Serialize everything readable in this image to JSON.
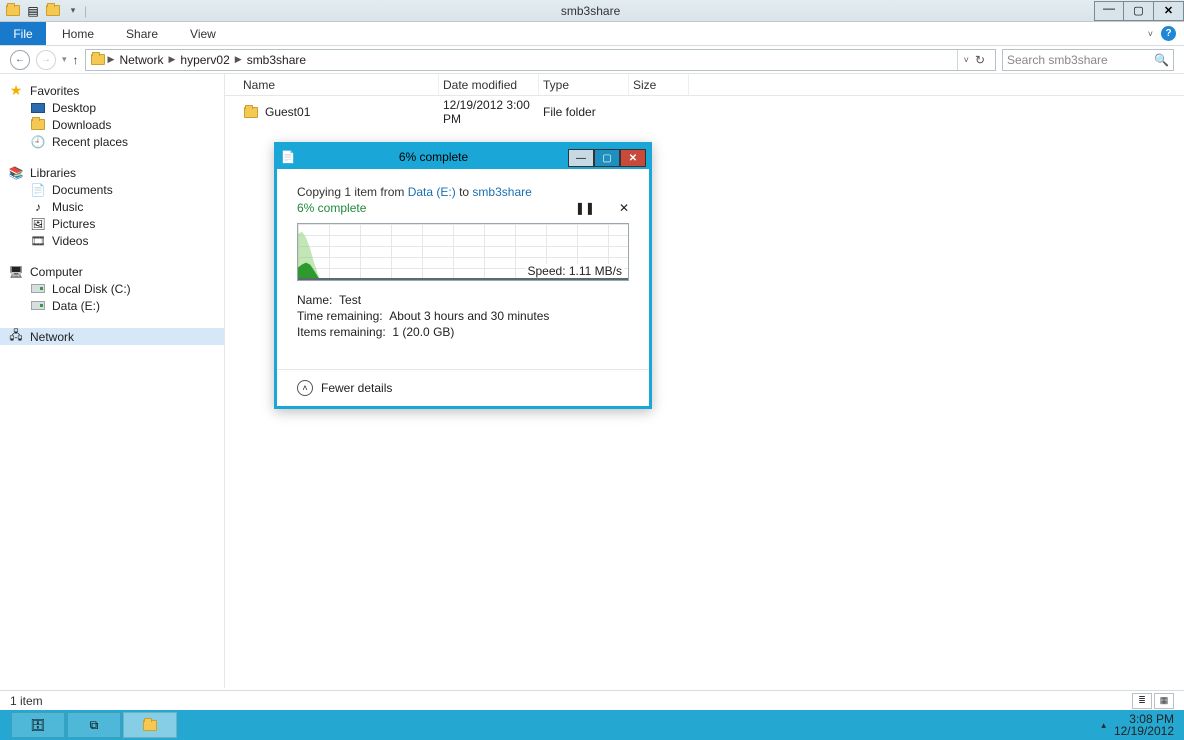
{
  "window": {
    "title": "smb3share"
  },
  "ribbon": {
    "file": "File",
    "tabs": [
      "Home",
      "Share",
      "View"
    ]
  },
  "nav": {
    "crumbs": [
      "Network",
      "hyperv02",
      "smb3share"
    ],
    "search_placeholder": "Search smb3share"
  },
  "sidebar": {
    "favorites": {
      "label": "Favorites",
      "items": [
        "Desktop",
        "Downloads",
        "Recent places"
      ]
    },
    "libraries": {
      "label": "Libraries",
      "items": [
        "Documents",
        "Music",
        "Pictures",
        "Videos"
      ]
    },
    "computer": {
      "label": "Computer",
      "items": [
        "Local Disk (C:)",
        "Data (E:)"
      ]
    },
    "network": {
      "label": "Network"
    }
  },
  "columns": {
    "name": "Name",
    "date": "Date modified",
    "type": "Type",
    "size": "Size"
  },
  "rows": [
    {
      "name": "Guest01",
      "date": "12/19/2012 3:00 PM",
      "type": "File folder",
      "size": ""
    }
  ],
  "status": {
    "text": "1 item"
  },
  "taskbar": {
    "time": "3:08 PM",
    "date": "12/19/2012"
  },
  "dialog": {
    "title": "6% complete",
    "copy_prefix": "Copying 1 item from ",
    "src": "Data (E:)",
    "mid": " to ",
    "dst": "smb3share",
    "percent": "6% complete",
    "speed": "Speed: 1.11 MB/s",
    "name_label": "Name:",
    "name_val": "Test",
    "time_label": "Time remaining:",
    "time_val": "About 3 hours and 30 minutes",
    "items_label": "Items remaining:",
    "items_val": "1 (20.0 GB)",
    "fewer": "Fewer details"
  }
}
